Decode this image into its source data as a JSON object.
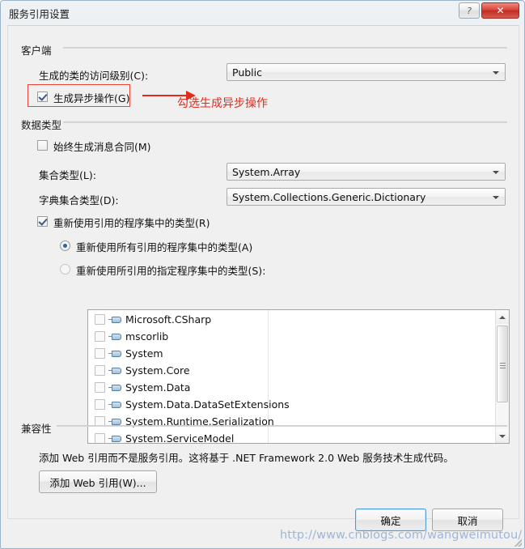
{
  "window": {
    "title": "服务引用设置",
    "help_button": "?",
    "close_button": "✕"
  },
  "client_group": {
    "legend": "客户端",
    "access_level_label": "生成的类的访问级别(C):",
    "access_level_value": "Public",
    "async_checkbox_label": "生成异步操作(G)",
    "async_checked": true
  },
  "data_types_group": {
    "legend": "数据类型",
    "message_contract_label": "始终生成消息合同(M)",
    "message_contract_checked": false,
    "collection_type_label": "集合类型(L):",
    "collection_type_value": "System.Array",
    "dictionary_type_label": "字典集合类型(D):",
    "dictionary_type_value": "System.Collections.Generic.Dictionary",
    "reuse_types_label": "重新使用引用的程序集中的类型(R)",
    "reuse_types_checked": true,
    "reuse_all_label": "重新使用所有引用的程序集中的类型(A)",
    "reuse_specified_label": "重新使用所引用的指定程序集中的类型(S):",
    "selected_radio": "reuse_all",
    "assemblies": [
      {
        "name": "Microsoft.CSharp",
        "checked": false
      },
      {
        "name": "mscorlib",
        "checked": false
      },
      {
        "name": "System",
        "checked": false
      },
      {
        "name": "System.Core",
        "checked": false
      },
      {
        "name": "System.Data",
        "checked": false
      },
      {
        "name": "System.Data.DataSetExtensions",
        "checked": false
      },
      {
        "name": "System.Runtime.Serialization",
        "checked": false
      },
      {
        "name": "System.ServiceModel",
        "checked": false
      }
    ]
  },
  "compatibility_group": {
    "legend": "兼容性",
    "description": "添加 Web 引用而不是服务引用。这将基于 .NET Framework 2.0 Web 服务技术生成代码。",
    "add_web_reference_button": "添加 Web 引用(W)..."
  },
  "footer": {
    "ok_button": "确定",
    "cancel_button": "取消"
  },
  "annotation": {
    "text": "勾选生成异步操作",
    "color": "#e02b1d"
  },
  "watermark": {
    "url": "http://www.cnblogs.com/wangweimutou/"
  }
}
